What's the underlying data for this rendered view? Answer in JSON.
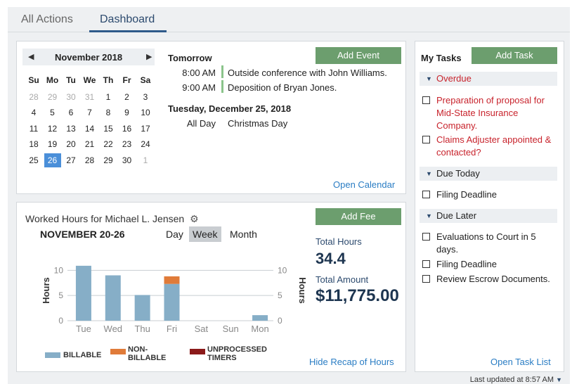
{
  "tabs": [
    {
      "label": "All Actions",
      "active": false
    },
    {
      "label": "Dashboard",
      "active": true
    }
  ],
  "calendar": {
    "month_label": "November 2018",
    "prev_icon": "triangle-left-icon",
    "next_icon": "triangle-right-icon",
    "weekdays": [
      "Su",
      "Mo",
      "Tu",
      "We",
      "Th",
      "Fr",
      "Sa"
    ],
    "weeks": [
      [
        "28",
        "29",
        "30",
        "31",
        "1",
        "2",
        "3"
      ],
      [
        "4",
        "5",
        "6",
        "7",
        "8",
        "9",
        "10"
      ],
      [
        "11",
        "12",
        "13",
        "14",
        "15",
        "16",
        "17"
      ],
      [
        "18",
        "19",
        "20",
        "21",
        "22",
        "23",
        "24"
      ],
      [
        "25",
        "26",
        "27",
        "28",
        "29",
        "30",
        "1"
      ]
    ],
    "selected_day": "26",
    "add_event_label": "Add Event",
    "open_calendar_label": "Open Calendar",
    "events": [
      {
        "day": "Tomorrow",
        "items": [
          {
            "time": "8:00 AM",
            "title": "Outside conference with John Williams."
          },
          {
            "time": "9:00 AM",
            "title": "Deposition of Bryan Jones."
          }
        ]
      },
      {
        "day": "Tuesday, December 25, 2018",
        "items": [
          {
            "time": "All Day",
            "title": "Christmas Day"
          }
        ]
      }
    ]
  },
  "hours": {
    "title": "Worked Hours for Michael L. Jensen",
    "range_label": "NOVEMBER 20-26",
    "periods": [
      "Day",
      "Week",
      "Month"
    ],
    "selected_period": "Week",
    "add_fee_label": "Add Fee",
    "total_hours_label": "Total Hours",
    "total_hours_value": "34.4",
    "total_amount_label": "Total Amount",
    "total_amount_value": "$11,775.00",
    "hide_recap_label": "Hide Recap of Hours",
    "legend": [
      {
        "line1": "BILLABLE",
        "line2": "",
        "color": "#86aec7"
      },
      {
        "line1": "NON-",
        "line2": "BILLABLE",
        "color": "#e07b39"
      },
      {
        "line1": "UNPROCESSED",
        "line2": "TIMERS",
        "color": "#8b1a1a"
      }
    ]
  },
  "chart_data": {
    "type": "bar",
    "categories": [
      "Tue",
      "Wed",
      "Thu",
      "Fri",
      "Sat",
      "Sun",
      "Mon"
    ],
    "series": [
      {
        "name": "BILLABLE",
        "values": [
          10.9,
          9.0,
          5.1,
          7.3,
          0,
          0,
          1.1
        ],
        "color": "#86aec7"
      },
      {
        "name": "NON-BILLABLE",
        "values": [
          0,
          0,
          0,
          1.5,
          0,
          0,
          0
        ],
        "color": "#e07b39"
      },
      {
        "name": "UNPROCESSED TIMERS",
        "values": [
          0,
          0,
          0,
          0,
          0,
          0,
          0
        ],
        "color": "#8b1a1a"
      }
    ],
    "yticks": [
      "0",
      "5",
      "10"
    ],
    "ylabel_left": "Hours",
    "ylabel_right": "Hours",
    "ylim": [
      0,
      12
    ],
    "stacked": true,
    "grid": true
  },
  "tasks": {
    "title": "My Tasks",
    "add_task_label": "Add Task",
    "open_task_list_label": "Open Task List",
    "sections": [
      {
        "label": "Overdue",
        "overdue": true,
        "items": [
          "Preparation of proposal for Mid-State Insurance Company.",
          "Claims Adjuster appointed & contacted?"
        ]
      },
      {
        "label": "Due Today",
        "overdue": false,
        "items": [
          "Filing Deadline"
        ]
      },
      {
        "label": "Due Later",
        "overdue": false,
        "items": [
          "Evaluations to Court in 5 days.",
          "Filing Deadline",
          "Review Escrow Documents."
        ]
      }
    ]
  },
  "last_updated": "Last updated at 8:57 AM"
}
